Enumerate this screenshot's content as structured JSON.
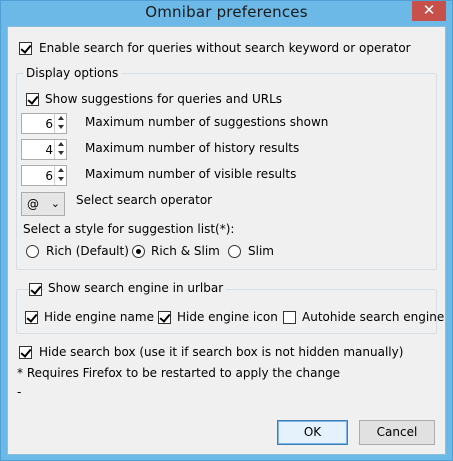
{
  "window": {
    "title": "Omnibar preferences",
    "close_glyph": "✕"
  },
  "enable_search": {
    "label": "Enable search for queries without search keyword or operator",
    "checked": true
  },
  "display_options": {
    "title": "Display options",
    "show_suggestions": {
      "label": "Show suggestions for queries and URLs",
      "checked": true
    },
    "max_suggestions": {
      "value": "6",
      "label": "Maximum number of suggestions shown"
    },
    "max_history": {
      "value": "4",
      "label": "Maximum number of history results"
    },
    "max_visible": {
      "value": "6",
      "label": "Maximum number of visible results"
    },
    "operator": {
      "value": "@",
      "label": "Select search operator"
    },
    "style": {
      "label": "Select a style for suggestion list(*):",
      "options": [
        "Rich (Default)",
        "Rich & Slim",
        "Slim"
      ],
      "selected": "Rich & Slim"
    }
  },
  "engine_group": {
    "show_engine": {
      "label": "Show search engine in urlbar",
      "checked": true
    },
    "hide_name": {
      "label": "Hide engine name",
      "checked": true
    },
    "hide_icon": {
      "label": "Hide engine icon",
      "checked": true
    },
    "autohide": {
      "label": "Autohide search engine",
      "checked": false
    }
  },
  "hide_search_box": {
    "label": "Hide search box (use it if search box is not hidden manually)",
    "checked": true
  },
  "restart_note": "* Requires Firefox to be restarted to apply the change",
  "dash": "-",
  "buttons": {
    "ok": "OK",
    "cancel": "Cancel"
  },
  "colors": {
    "titlebar": "#6cb8e6",
    "close": "#c7504a",
    "client": "#f0f0f0"
  }
}
